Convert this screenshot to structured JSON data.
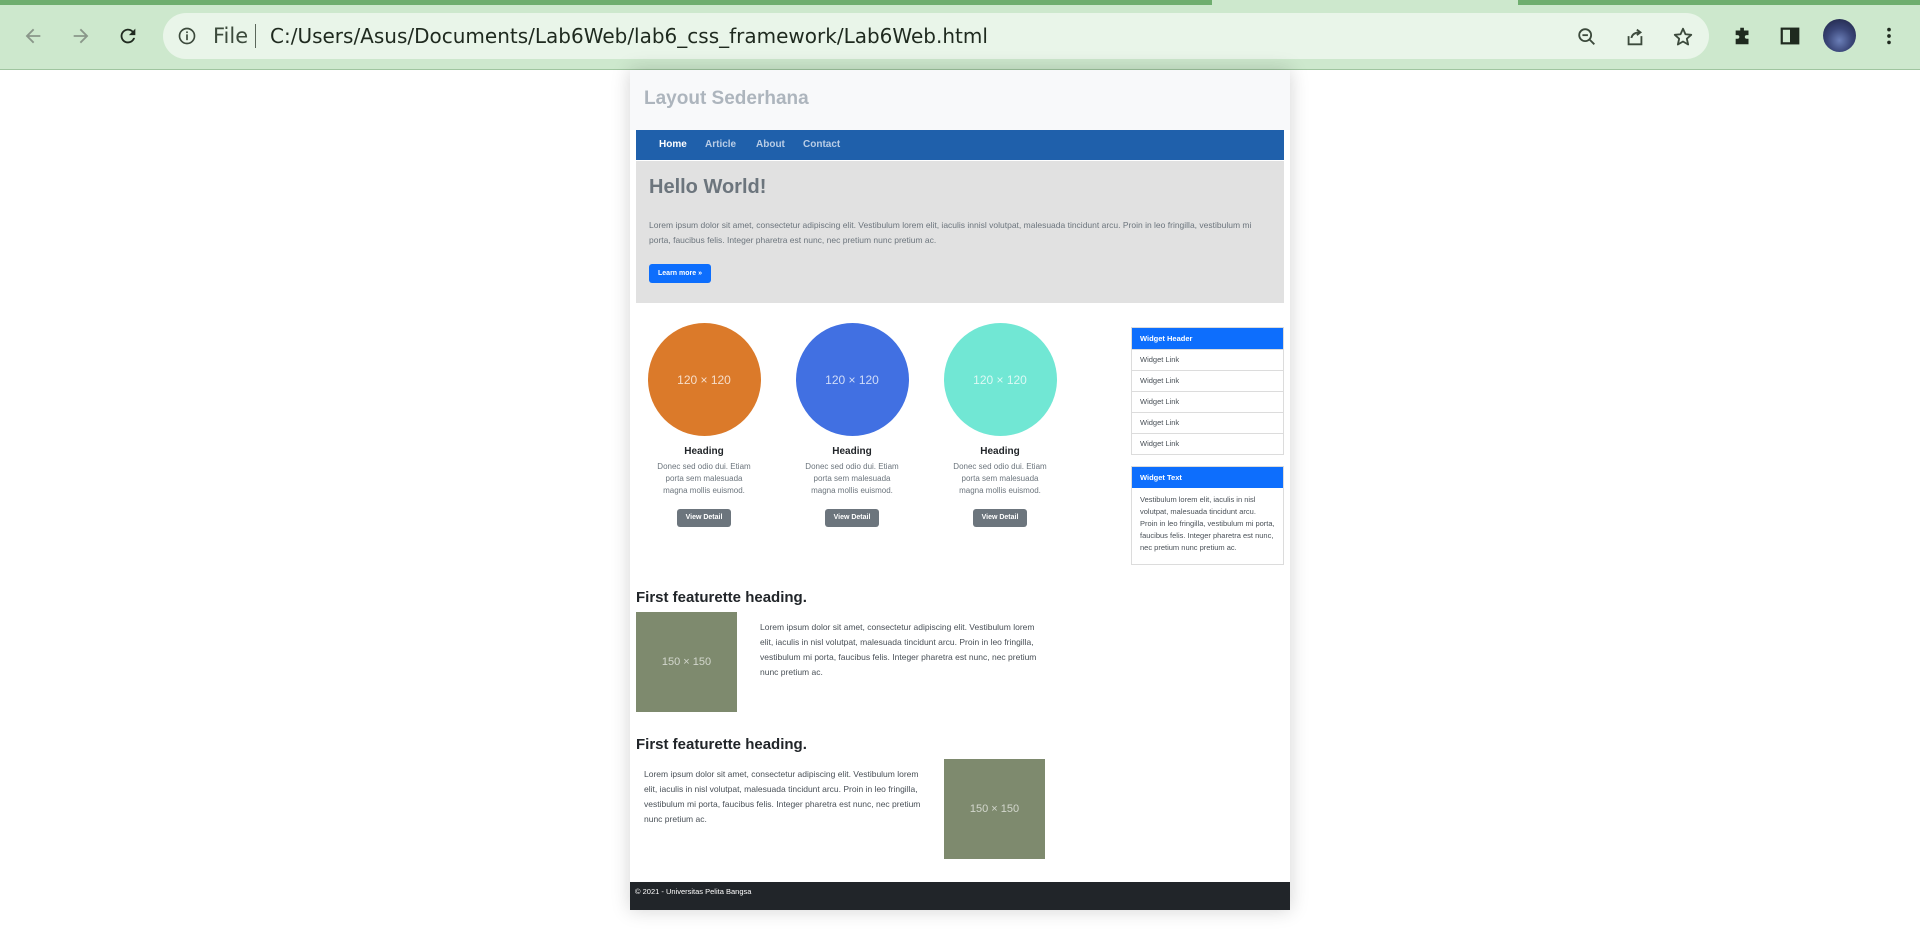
{
  "browser": {
    "url_scheme_label": "File",
    "url": "C:/Users/Asus/Documents/Lab6Web/lab6_css_framework/Lab6Web.html",
    "icons": [
      "back-icon",
      "forward-icon",
      "reload-icon",
      "info-icon",
      "zoom-out-icon",
      "share-icon",
      "star-icon",
      "extensions-icon",
      "side-panel-icon",
      "profile-avatar",
      "menu-icon"
    ]
  },
  "site": {
    "title": "Layout Sederhana",
    "nav": [
      {
        "label": "Home"
      },
      {
        "label": "Article"
      },
      {
        "label": "About"
      },
      {
        "label": "Contact"
      }
    ],
    "hero": {
      "title": "Hello World!",
      "text": "Lorem ipsum dolor sit amet, consectetur adipiscing elit. Vestibulum lorem elit, iaculis innisl volutpat, malesuada tincidunt arcu. Proin in leo fringilla, vestibulum mi porta, faucibus felis. Integer pharetra est nunc, nec pretium nunc pretium ac.",
      "button": "Learn more »"
    },
    "cards": [
      {
        "placeholder": "120 × 120",
        "color": "#db7a2a",
        "heading": "Heading",
        "text": "Donec sed odio dui. Etiam porta sem malesuada magna mollis euismod.",
        "button": "View Detail"
      },
      {
        "placeholder": "120 × 120",
        "color": "#4170e2",
        "heading": "Heading",
        "text": "Donec sed odio dui. Etiam porta sem malesuada magna mollis euismod.",
        "button": "View Detail"
      },
      {
        "placeholder": "120 × 120",
        "color": "#71e7d4",
        "heading": "Heading",
        "text": "Donec sed odio dui. Etiam porta sem malesuada magna mollis euismod.",
        "button": "View Detail"
      }
    ],
    "widget_links": {
      "header": "Widget Header",
      "links": [
        "Widget Link",
        "Widget Link",
        "Widget Link",
        "Widget Link",
        "Widget Link"
      ]
    },
    "widget_text": {
      "header": "Widget Text",
      "body": "Vestibulum lorem elit, iaculis in nisl volutpat, malesuada tincidunt arcu. Proin in leo fringilla, vestibulum mi porta, faucibus felis. Integer pharetra est nunc, nec pretium nunc pretium ac."
    },
    "featurettes": [
      {
        "heading": "First featurette heading.",
        "placeholder": "150 × 150",
        "text": "Lorem ipsum dolor sit amet, consectetur adipiscing elit. Vestibulum lorem elit, iaculis in nisl volutpat, malesuada tincidunt arcu. Proin in leo fringilla, vestibulum mi porta, faucibus felis. Integer pharetra est nunc, nec pretium nunc pretium ac."
      },
      {
        "heading": "First featurette heading.",
        "placeholder": "150 × 150",
        "text": "Lorem ipsum dolor sit amet, consectetur adipiscing elit. Vestibulum lorem elit, iaculis in nisl volutpat, malesuada tincidunt arcu. Proin in leo fringilla, vestibulum mi porta, faucibus felis. Integer pharetra est nunc, nec pretium nunc pretium ac."
      }
    ],
    "footer": "© 2021 - Universitas Pelita Bangsa"
  }
}
